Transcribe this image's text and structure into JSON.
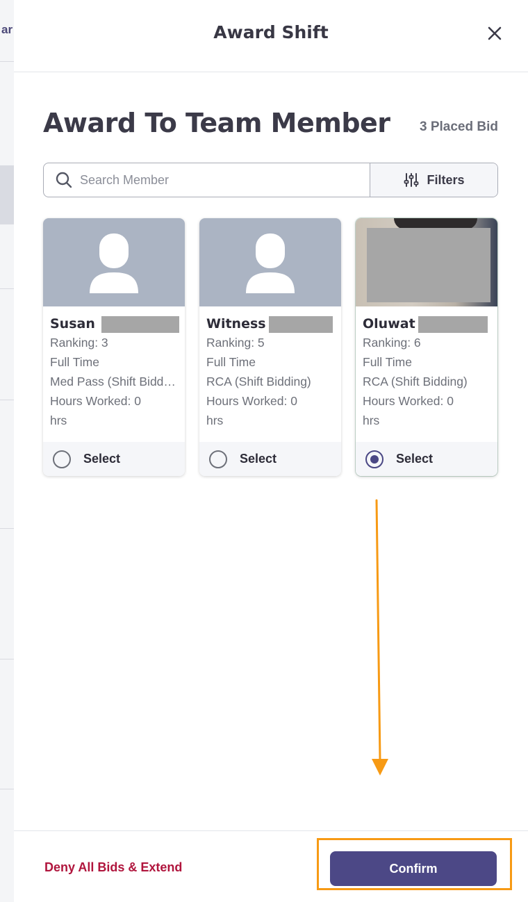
{
  "background": {
    "peek_text": "ar"
  },
  "modal": {
    "title": "Award Shift",
    "close_icon": "close-icon"
  },
  "section": {
    "title": "Award To Team Member",
    "bid_count": "3 Placed Bid"
  },
  "search": {
    "placeholder": "Search Member",
    "value": "",
    "filters_label": "Filters"
  },
  "members": [
    {
      "name": "Susan",
      "ranking": "Ranking: 3",
      "employment": "Full Time",
      "position": "Med Pass (Shift Bidding)",
      "hours_line": "Hours Worked: 0",
      "hours_unit": "hrs",
      "select_label": "Select",
      "selected": false
    },
    {
      "name": "Witness",
      "ranking": "Ranking: 5",
      "employment": "Full Time",
      "position": "RCA (Shift Bidding)",
      "hours_line": "Hours Worked: 0",
      "hours_unit": "hrs",
      "select_label": "Select",
      "selected": false
    },
    {
      "name": "Oluwat",
      "ranking": "Ranking: 6",
      "employment": "Full Time",
      "position": "RCA (Shift Bidding)",
      "hours_line": "Hours Worked: 0",
      "hours_unit": "hrs",
      "select_label": "Select",
      "selected": true
    }
  ],
  "footer": {
    "deny_label": "Deny All Bids & Extend",
    "confirm_label": "Confirm"
  },
  "colors": {
    "accent": "#4c4886",
    "danger": "#b0153d",
    "annotation": "#f79a14"
  }
}
